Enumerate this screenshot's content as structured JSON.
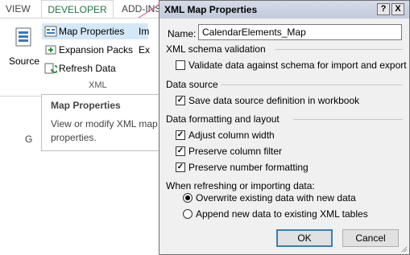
{
  "ribbon": {
    "tabs": {
      "view": "VIEW",
      "developer": "DEVELOPER",
      "addins": "ADD-INS"
    },
    "source_label": "Source",
    "map_properties_label": "Map Properties",
    "expansion_packs_label": "Expansion Packs",
    "refresh_data_label": "Refresh Data",
    "import_cut": "Im",
    "export_cut": "Ex",
    "group_label": "XML",
    "accent_color": "#217346"
  },
  "tooltip": {
    "title": "Map Properties",
    "description": "View or modify XML map properties."
  },
  "sheet": {
    "column_header": "G"
  },
  "dialog": {
    "title": "XML Map Properties",
    "help_glyph": "?",
    "close_glyph": "X",
    "name_label": "Name:",
    "name_value": "CalendarElements_Map",
    "schema_section": "XML schema validation",
    "validate_label": "Validate data against schema for import and export",
    "validate_checked": false,
    "source_section": "Data source",
    "save_source_label": "Save data source definition in workbook",
    "save_source_checked": true,
    "format_section": "Data formatting and layout",
    "adjust_width_label": "Adjust column width",
    "adjust_width_checked": true,
    "preserve_filter_label": "Preserve column filter",
    "preserve_filter_checked": true,
    "preserve_number_label": "Preserve number formatting",
    "preserve_number_checked": true,
    "refresh_section": "When refreshing or importing data:",
    "overwrite_label": "Overwrite existing data with new data",
    "overwrite_selected": true,
    "append_label": "Append new data to existing XML tables",
    "append_selected": false,
    "ok_label": "OK",
    "cancel_label": "Cancel"
  }
}
